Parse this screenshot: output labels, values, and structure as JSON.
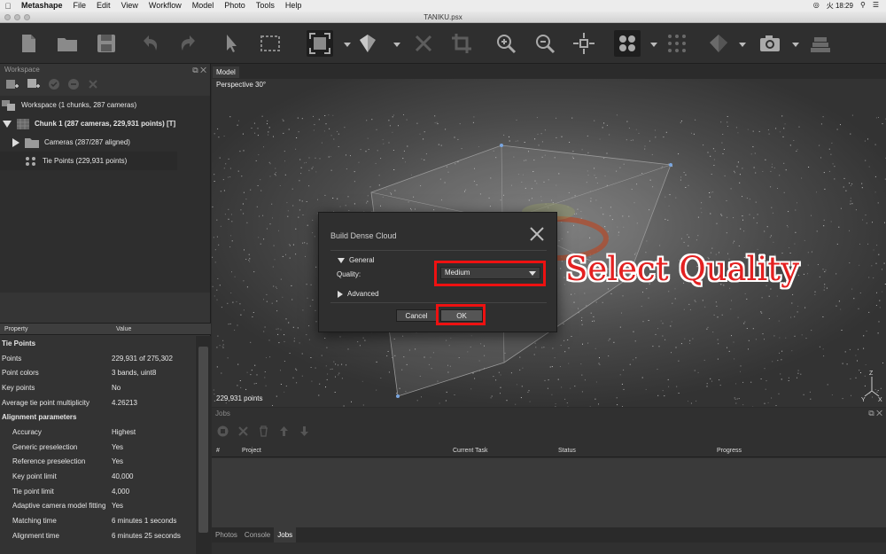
{
  "menubar": {
    "app": "Metashape",
    "items": [
      "File",
      "Edit",
      "View",
      "Workflow",
      "Model",
      "Photo",
      "Tools",
      "Help"
    ],
    "clock": "火 18:29"
  },
  "window": {
    "title": "TANIKU.psx"
  },
  "workspace": {
    "header": "Workspace",
    "summary": "Workspace (1 chunks, 287 cameras)",
    "chunk": "Chunk 1 (287 cameras, 229,931 points) [T]",
    "cameras": "Cameras (287/287 aligned)",
    "tie_points": "Tie Points (229,931 points)"
  },
  "properties": {
    "col_property": "Property",
    "col_value": "Value",
    "rows": [
      {
        "k": "Tie Points",
        "v": "",
        "section": true
      },
      {
        "k": "Points",
        "v": "229,931 of 275,302"
      },
      {
        "k": "Point colors",
        "v": "3 bands, uint8"
      },
      {
        "k": "Key points",
        "v": "No"
      },
      {
        "k": "Average tie point multiplicity",
        "v": "4.26213"
      },
      {
        "k": "Alignment parameters",
        "v": "",
        "section": true
      },
      {
        "k": "Accuracy",
        "v": "Highest",
        "indent": true
      },
      {
        "k": "Generic preselection",
        "v": "Yes",
        "indent": true
      },
      {
        "k": "Reference preselection",
        "v": "Yes",
        "indent": true
      },
      {
        "k": "Key point limit",
        "v": "40,000",
        "indent": true
      },
      {
        "k": "Tie point limit",
        "v": "4,000",
        "indent": true
      },
      {
        "k": "Adaptive camera model fitting",
        "v": "Yes",
        "indent": true
      },
      {
        "k": "Matching time",
        "v": "6 minutes 1 seconds",
        "indent": true
      },
      {
        "k": "Alignment time",
        "v": "6 minutes 25 seconds",
        "indent": true
      }
    ]
  },
  "viewport": {
    "tab": "Model",
    "projection": "Perspective 30°",
    "point_count": "229,931 points"
  },
  "jobs": {
    "title": "Jobs",
    "columns": [
      "#",
      "Project",
      "Current Task",
      "Status",
      "Progress"
    ],
    "tabs": [
      "Photos",
      "Console",
      "Jobs"
    ]
  },
  "dialog": {
    "title": "Build Dense Cloud",
    "general": "General",
    "quality_label": "Quality:",
    "quality_value": "Medium",
    "advanced": "Advanced",
    "cancel": "Cancel",
    "ok": "OK"
  },
  "annotation": {
    "text": "Select Quality",
    "color": "#e42020"
  }
}
